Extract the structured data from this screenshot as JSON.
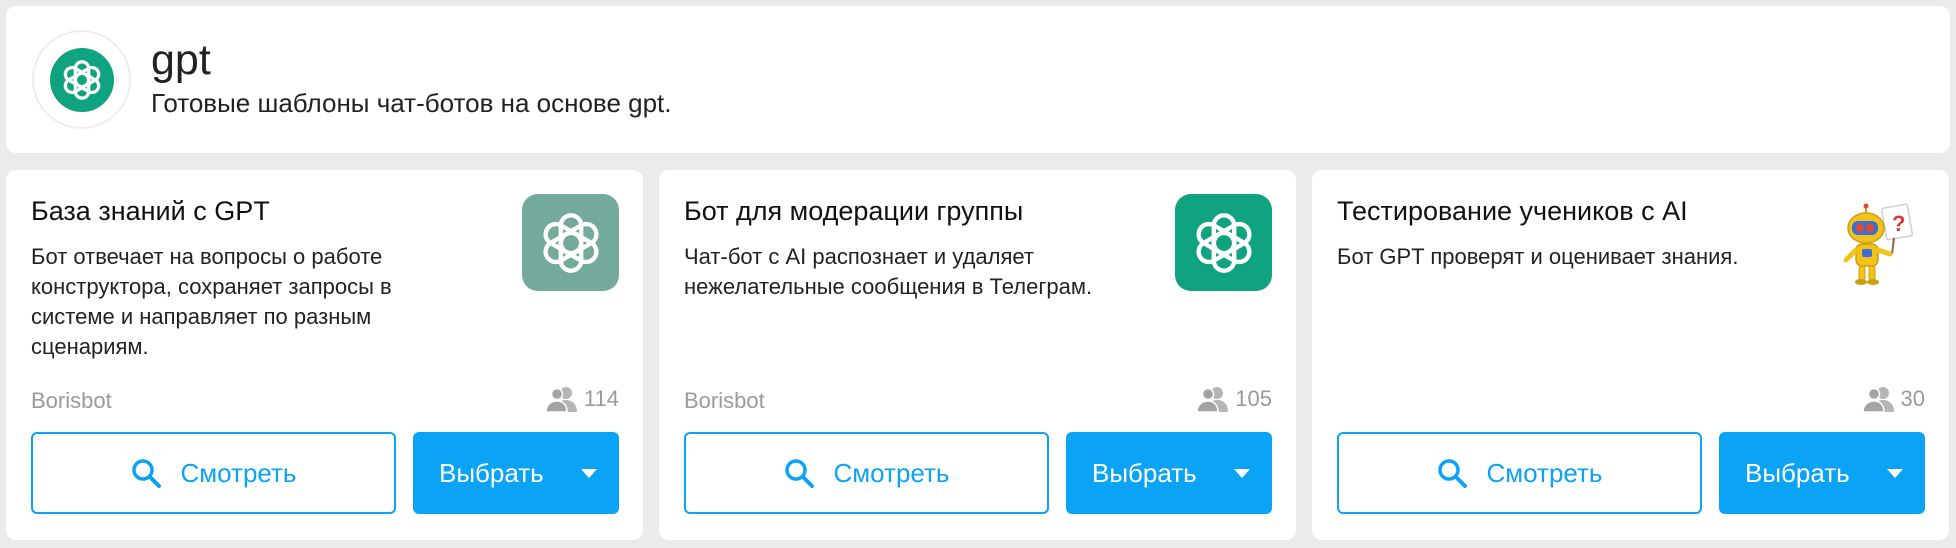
{
  "header": {
    "title": "gpt",
    "subtitle": "Готовые шаблоны чат-ботов на основе gpt.",
    "logo_icon": "openai-icon"
  },
  "colors": {
    "accent": "#0aa3f5",
    "openai_green": "#10a37f",
    "openai_muted": "#74aa9c"
  },
  "cards": [
    {
      "title": "База знаний с GPT",
      "description": "Бот отвечает на вопросы о работе конструктора, сохраняет запросы в системе и направляет по разным сценариям.",
      "author": "Borisbot",
      "users": "114",
      "view_label": "Смотреть",
      "choose_label": "Выбрать",
      "image_icon": "openai-icon"
    },
    {
      "title": "Бот для модерации группы",
      "description": "Чат-бот с AI распознает и удаляет нежелательные сообщения в Телеграм.",
      "author": "Borisbot",
      "users": "105",
      "view_label": "Смотреть",
      "choose_label": "Выбрать",
      "image_icon": "openai-icon"
    },
    {
      "title": "Тестирование учеников с AI",
      "description": "Бот GPT проверят и оценивает знания.",
      "author": "",
      "users": "30",
      "view_label": "Смотреть",
      "choose_label": "Выбрать",
      "image_icon": "robot-question-icon"
    }
  ]
}
